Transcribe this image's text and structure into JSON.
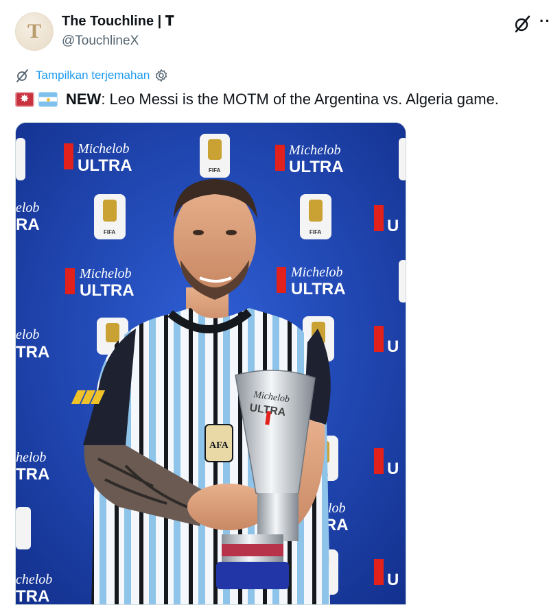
{
  "author": {
    "display_name": "The Touchline | 𝐓",
    "handle": "@TouchlineX",
    "avatar_letter": "T"
  },
  "header": {
    "more_label": "··"
  },
  "translate": {
    "label": "Tampilkan terjemahan"
  },
  "tweet": {
    "prefix": "NEW",
    "body": ": Leo Messi is the MOTM of the Argentina vs. Algeria game."
  },
  "media": {
    "backdrop_brand_top": "Michelob",
    "backdrop_brand_bottom": "ULTRA",
    "badge_text": "FIFA",
    "trophy_text_top": "Michelob",
    "trophy_text_bottom": "ULTRA",
    "jersey_badge": "AFA"
  },
  "colors": {
    "link": "#1d9bf0",
    "muted": "#536471",
    "backdrop": "#1a3fa6",
    "brand_red": "#e2211c"
  }
}
